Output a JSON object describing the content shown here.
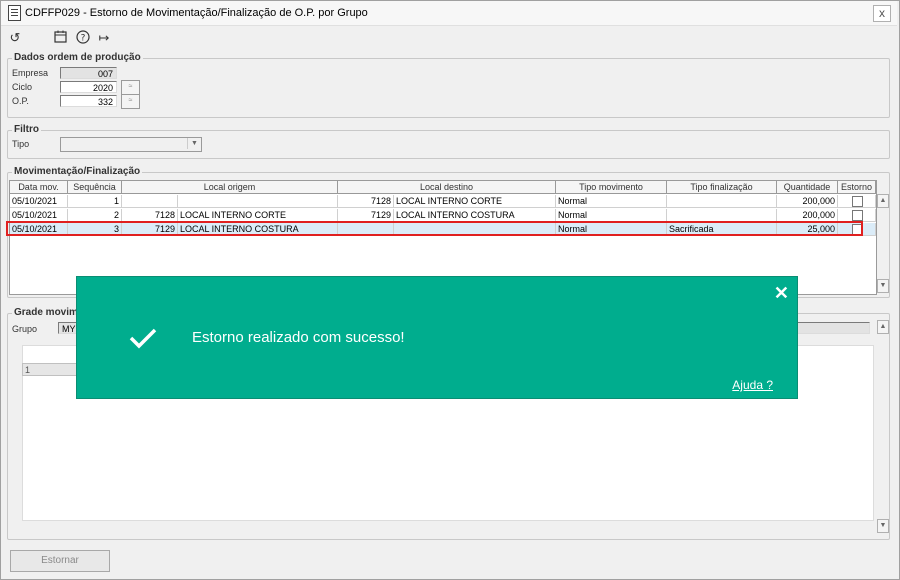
{
  "window": {
    "title": "CDFFP029 - Estorno de Movimentação/Finalização de O.P. por Grupo",
    "close_glyph": "x"
  },
  "toolbar": {
    "undo_glyph": "↺",
    "calendar_glyph": "🗓",
    "help_glyph": "?",
    "exit_glyph": "↦"
  },
  "dados": {
    "legend": "Dados ordem de produção",
    "empresa_label": "Empresa",
    "empresa_value": "007",
    "ciclo_label": "Ciclo",
    "ciclo_value": "2020",
    "op_label": "O.P.",
    "op_value": "332",
    "pick_glyph": "≈"
  },
  "filtro": {
    "legend": "Filtro",
    "tipo_label": "Tipo",
    "tipo_value": ""
  },
  "mov": {
    "legend": "Movimentação/Finalização",
    "columns": [
      "Data mov.",
      "Sequência",
      "Local origem",
      "Local destino",
      "Tipo movimento",
      "Tipo finalização",
      "Quantidade",
      "Estorno"
    ],
    "rows": [
      {
        "data": "05/10/2021",
        "seq": "1",
        "orig_cod": "",
        "orig_nome": "",
        "dest_cod": "7128",
        "dest_nome": "LOCAL INTERNO CORTE",
        "tipo_mov": "Normal",
        "tipo_fin": "",
        "qtd": "200,000"
      },
      {
        "data": "05/10/2021",
        "seq": "2",
        "orig_cod": "7128",
        "orig_nome": "LOCAL INTERNO CORTE",
        "dest_cod": "7129",
        "dest_nome": "LOCAL INTERNO COSTURA",
        "tipo_mov": "Normal",
        "tipo_fin": "",
        "qtd": "200,000"
      },
      {
        "data": "05/10/2021",
        "seq": "3",
        "orig_cod": "7129",
        "orig_nome": "LOCAL INTERNO COSTURA",
        "dest_cod": "",
        "dest_nome": "",
        "tipo_mov": "Normal",
        "tipo_fin": "Sacrificada",
        "qtd": "25,000"
      }
    ]
  },
  "grade": {
    "legend": "Grade movim",
    "grupo_label": "Grupo",
    "grupo_value": "MY",
    "cell_value": "1"
  },
  "toast": {
    "message": "Estorno realizado com sucesso!",
    "help_link": "Ajuda ?",
    "close_glyph": "✕"
  },
  "actions": {
    "estornar_label": "Estornar"
  },
  "colors": {
    "toast_bg": "#00ad8e",
    "selected_row": "#dbecf8",
    "highlight_border": "#e02020"
  }
}
